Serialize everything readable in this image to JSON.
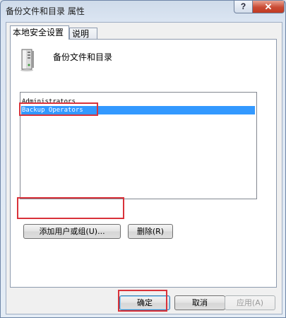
{
  "window": {
    "title": "备份文件和目录 属性",
    "help_label": "?",
    "close_label": "✕"
  },
  "tabs": [
    {
      "label": "本地安全设置",
      "active": true
    },
    {
      "label": "说明",
      "active": false
    }
  ],
  "policy": {
    "icon": "server-icon",
    "name": "备份文件和目录"
  },
  "members": [
    {
      "label": "Administrators",
      "selected": false
    },
    {
      "label": "Backup Operators",
      "selected": true
    }
  ],
  "buttons": {
    "add": "添加用户或组(U)...",
    "remove": "删除(R)",
    "ok": "确定",
    "cancel": "取消",
    "apply": "应用(A)"
  },
  "colors": {
    "selection": "#3399ff",
    "highlight_box": "#d9323a"
  }
}
